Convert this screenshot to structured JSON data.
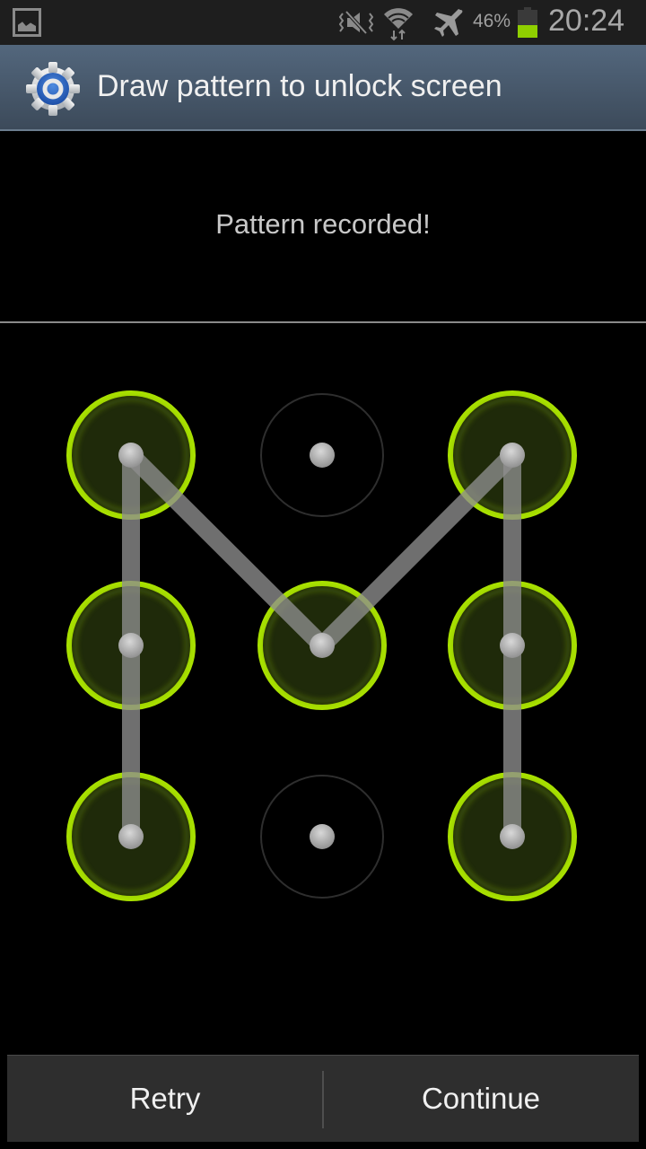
{
  "status_bar": {
    "notification_icon": "gallery-icon",
    "icons": [
      "mute-vibrate-icon",
      "wifi-data-icon",
      "airplane-mode-icon"
    ],
    "battery_percent": "46%",
    "battery_level": 0.46,
    "battery_color": "#8fcf00",
    "time": "20:24"
  },
  "title_bar": {
    "icon": "settings-gear-icon",
    "title": "Draw pattern to unlock screen"
  },
  "message": "Pattern recorded!",
  "pattern": {
    "accent_color": "#a8e000",
    "grid_size": 3,
    "selected": [
      [
        0,
        2
      ],
      [
        0,
        1
      ],
      [
        0,
        0
      ],
      [
        1,
        1
      ],
      [
        2,
        0
      ],
      [
        2,
        1
      ],
      [
        2,
        2
      ]
    ],
    "unselected": [
      [
        1,
        0
      ],
      [
        1,
        2
      ]
    ]
  },
  "buttons": {
    "retry": "Retry",
    "continue": "Continue"
  }
}
